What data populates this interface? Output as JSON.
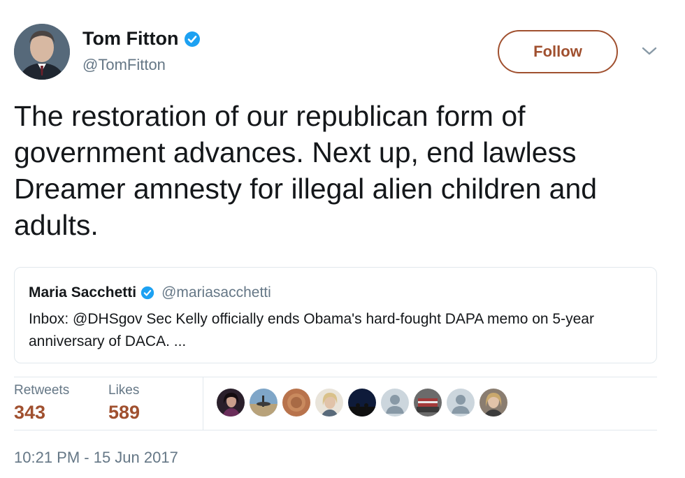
{
  "tweet": {
    "author": {
      "name": "Tom Fitton",
      "handle": "@TomFitton",
      "verified": true,
      "avatar_icon": "profile-photo"
    },
    "follow_label": "Follow",
    "text": "The restoration of our republican form of government advances. Next up, end lawless Dreamer amnesty for illegal alien children and adults.",
    "quoted": {
      "name": "Maria Sacchetti",
      "handle": "@mariasacchetti",
      "verified": true,
      "text": "Inbox: @DHSgov Sec Kelly officially ends Obama's hard-fought DAPA memo on 5-year anniversary of DACA. ..."
    },
    "stats": {
      "retweets_label": "Retweets",
      "retweets": "343",
      "likes_label": "Likes",
      "likes": "589"
    },
    "likers_count_shown": 9,
    "timestamp": "10:21 PM - 15 Jun 2017"
  },
  "colors": {
    "accent": "#a0502f",
    "verified_blue": "#1da1f2",
    "secondary_text": "#657786",
    "border": "#e1e8ed"
  }
}
